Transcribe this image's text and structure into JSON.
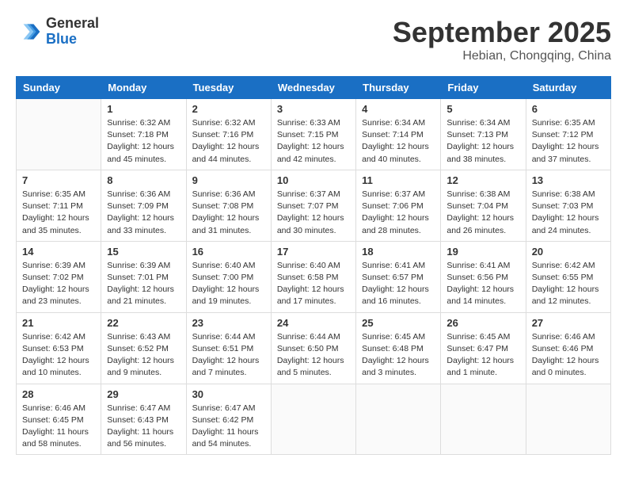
{
  "header": {
    "logo_general": "General",
    "logo_blue": "Blue",
    "month": "September 2025",
    "location": "Hebian, Chongqing, China"
  },
  "days_of_week": [
    "Sunday",
    "Monday",
    "Tuesday",
    "Wednesday",
    "Thursday",
    "Friday",
    "Saturday"
  ],
  "weeks": [
    [
      {
        "day": "",
        "info": ""
      },
      {
        "day": "1",
        "info": "Sunrise: 6:32 AM\nSunset: 7:18 PM\nDaylight: 12 hours\nand 45 minutes."
      },
      {
        "day": "2",
        "info": "Sunrise: 6:32 AM\nSunset: 7:16 PM\nDaylight: 12 hours\nand 44 minutes."
      },
      {
        "day": "3",
        "info": "Sunrise: 6:33 AM\nSunset: 7:15 PM\nDaylight: 12 hours\nand 42 minutes."
      },
      {
        "day": "4",
        "info": "Sunrise: 6:34 AM\nSunset: 7:14 PM\nDaylight: 12 hours\nand 40 minutes."
      },
      {
        "day": "5",
        "info": "Sunrise: 6:34 AM\nSunset: 7:13 PM\nDaylight: 12 hours\nand 38 minutes."
      },
      {
        "day": "6",
        "info": "Sunrise: 6:35 AM\nSunset: 7:12 PM\nDaylight: 12 hours\nand 37 minutes."
      }
    ],
    [
      {
        "day": "7",
        "info": "Sunrise: 6:35 AM\nSunset: 7:11 PM\nDaylight: 12 hours\nand 35 minutes."
      },
      {
        "day": "8",
        "info": "Sunrise: 6:36 AM\nSunset: 7:09 PM\nDaylight: 12 hours\nand 33 minutes."
      },
      {
        "day": "9",
        "info": "Sunrise: 6:36 AM\nSunset: 7:08 PM\nDaylight: 12 hours\nand 31 minutes."
      },
      {
        "day": "10",
        "info": "Sunrise: 6:37 AM\nSunset: 7:07 PM\nDaylight: 12 hours\nand 30 minutes."
      },
      {
        "day": "11",
        "info": "Sunrise: 6:37 AM\nSunset: 7:06 PM\nDaylight: 12 hours\nand 28 minutes."
      },
      {
        "day": "12",
        "info": "Sunrise: 6:38 AM\nSunset: 7:04 PM\nDaylight: 12 hours\nand 26 minutes."
      },
      {
        "day": "13",
        "info": "Sunrise: 6:38 AM\nSunset: 7:03 PM\nDaylight: 12 hours\nand 24 minutes."
      }
    ],
    [
      {
        "day": "14",
        "info": "Sunrise: 6:39 AM\nSunset: 7:02 PM\nDaylight: 12 hours\nand 23 minutes."
      },
      {
        "day": "15",
        "info": "Sunrise: 6:39 AM\nSunset: 7:01 PM\nDaylight: 12 hours\nand 21 minutes."
      },
      {
        "day": "16",
        "info": "Sunrise: 6:40 AM\nSunset: 7:00 PM\nDaylight: 12 hours\nand 19 minutes."
      },
      {
        "day": "17",
        "info": "Sunrise: 6:40 AM\nSunset: 6:58 PM\nDaylight: 12 hours\nand 17 minutes."
      },
      {
        "day": "18",
        "info": "Sunrise: 6:41 AM\nSunset: 6:57 PM\nDaylight: 12 hours\nand 16 minutes."
      },
      {
        "day": "19",
        "info": "Sunrise: 6:41 AM\nSunset: 6:56 PM\nDaylight: 12 hours\nand 14 minutes."
      },
      {
        "day": "20",
        "info": "Sunrise: 6:42 AM\nSunset: 6:55 PM\nDaylight: 12 hours\nand 12 minutes."
      }
    ],
    [
      {
        "day": "21",
        "info": "Sunrise: 6:42 AM\nSunset: 6:53 PM\nDaylight: 12 hours\nand 10 minutes."
      },
      {
        "day": "22",
        "info": "Sunrise: 6:43 AM\nSunset: 6:52 PM\nDaylight: 12 hours\nand 9 minutes."
      },
      {
        "day": "23",
        "info": "Sunrise: 6:44 AM\nSunset: 6:51 PM\nDaylight: 12 hours\nand 7 minutes."
      },
      {
        "day": "24",
        "info": "Sunrise: 6:44 AM\nSunset: 6:50 PM\nDaylight: 12 hours\nand 5 minutes."
      },
      {
        "day": "25",
        "info": "Sunrise: 6:45 AM\nSunset: 6:48 PM\nDaylight: 12 hours\nand 3 minutes."
      },
      {
        "day": "26",
        "info": "Sunrise: 6:45 AM\nSunset: 6:47 PM\nDaylight: 12 hours\nand 1 minute."
      },
      {
        "day": "27",
        "info": "Sunrise: 6:46 AM\nSunset: 6:46 PM\nDaylight: 12 hours\nand 0 minutes."
      }
    ],
    [
      {
        "day": "28",
        "info": "Sunrise: 6:46 AM\nSunset: 6:45 PM\nDaylight: 11 hours\nand 58 minutes."
      },
      {
        "day": "29",
        "info": "Sunrise: 6:47 AM\nSunset: 6:43 PM\nDaylight: 11 hours\nand 56 minutes."
      },
      {
        "day": "30",
        "info": "Sunrise: 6:47 AM\nSunset: 6:42 PM\nDaylight: 11 hours\nand 54 minutes."
      },
      {
        "day": "",
        "info": ""
      },
      {
        "day": "",
        "info": ""
      },
      {
        "day": "",
        "info": ""
      },
      {
        "day": "",
        "info": ""
      }
    ]
  ]
}
